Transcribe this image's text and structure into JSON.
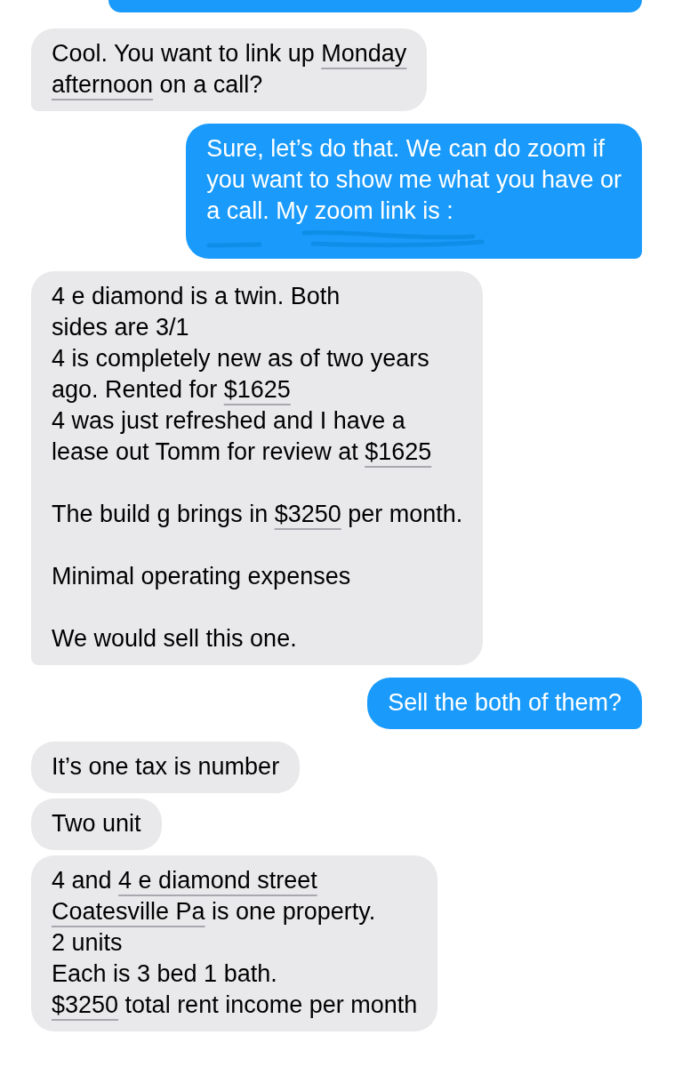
{
  "messages": [
    {
      "kind": "received",
      "tail": true,
      "paragraphs": [
        [
          [
            {
              "kind": "plain",
              "text": "Cool. You want to link up "
            },
            {
              "kind": "detected",
              "text": "Monday"
            }
          ],
          [
            {
              "kind": "detected",
              "text": "afternoon"
            },
            {
              "kind": "plain",
              "text": " on a call?"
            }
          ]
        ]
      ]
    },
    {
      "kind": "sent",
      "tail": true,
      "redacted": true,
      "paragraphs": [
        [
          [
            {
              "kind": "plain",
              "text": "Sure, let’s do that. We can do zoom if"
            }
          ],
          [
            {
              "kind": "plain",
              "text": "you want to show me what you have or"
            }
          ],
          [
            {
              "kind": "plain",
              "text": "a call. My zoom link is :"
            }
          ]
        ]
      ]
    },
    {
      "kind": "received",
      "tail": true,
      "paragraphs": [
        [
          [
            {
              "kind": "plain",
              "text": "4 e diamond is a twin. Both"
            }
          ],
          [
            {
              "kind": "plain",
              "text": "sides are 3/1"
            }
          ],
          [
            {
              "kind": "plain",
              "text": "4 is completely new as of two years"
            }
          ],
          [
            {
              "kind": "plain",
              "text": "ago. Rented for "
            },
            {
              "kind": "detected",
              "text": "$1625"
            }
          ],
          [
            {
              "kind": "plain",
              "text": "4 was just refreshed and I have a"
            }
          ],
          [
            {
              "kind": "plain",
              "text": "lease out Tomm for review at "
            },
            {
              "kind": "detected",
              "text": "$1625"
            }
          ]
        ],
        [
          [
            {
              "kind": "plain",
              "text": "The build g brings in "
            },
            {
              "kind": "detected",
              "text": "$3250"
            },
            {
              "kind": "plain",
              "text": " per month."
            }
          ]
        ],
        [
          [
            {
              "kind": "plain",
              "text": "Minimal operating expenses"
            }
          ]
        ],
        [
          [
            {
              "kind": "plain",
              "text": "We would sell this one."
            }
          ]
        ]
      ]
    },
    {
      "kind": "sent",
      "tail": true,
      "paragraphs": [
        [
          [
            {
              "kind": "plain",
              "text": "Sell the both of them?"
            }
          ]
        ]
      ]
    },
    {
      "kind": "received",
      "tail": false,
      "paragraphs": [
        [
          [
            {
              "kind": "plain",
              "text": "It’s one tax is number"
            }
          ]
        ]
      ]
    },
    {
      "kind": "received",
      "tail": false,
      "paragraphs": [
        [
          [
            {
              "kind": "plain",
              "text": "Two unit"
            }
          ]
        ]
      ]
    },
    {
      "kind": "received",
      "tail": false,
      "paragraphs": [
        [
          [
            {
              "kind": "plain",
              "text": "4 and "
            },
            {
              "kind": "detected",
              "text": "4 e diamond street"
            }
          ],
          [
            {
              "kind": "detected",
              "text": "Coatesville Pa"
            },
            {
              "kind": "plain",
              "text": " is one property."
            }
          ],
          [
            {
              "kind": "plain",
              "text": "2 units"
            }
          ],
          [
            {
              "kind": "plain",
              "text": "Each is 3 bed 1 bath."
            }
          ],
          [
            {
              "kind": "detected",
              "text": "$3250"
            },
            {
              "kind": "plain",
              "text": " total rent income per month"
            }
          ]
        ]
      ]
    }
  ]
}
